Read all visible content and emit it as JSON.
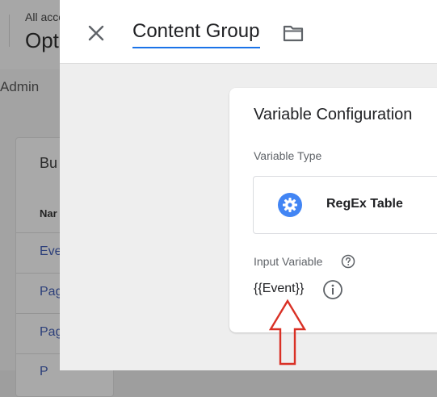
{
  "background": {
    "breadcrumb": "All acco",
    "account_name": "Opt",
    "admin_tab": "Admin",
    "card_title": "Bu",
    "column_header": "Nar",
    "rows": [
      "Eve",
      "Pag",
      "Pag",
      "P"
    ]
  },
  "panel": {
    "close_icon": "close-icon",
    "title": "Content Group",
    "folder_icon": "folder-icon",
    "card": {
      "title": "Variable Configuration",
      "variable_type_label": "Variable Type",
      "variable_type_name": "RegEx Table",
      "variable_type_icon": "gear-icon",
      "input_variable_label": "Input Variable",
      "help_icon": "help-circle-icon",
      "input_variable_value": "{{Event}}",
      "info_icon": "info-icon"
    }
  },
  "annotation": {
    "icon": "arrow-up-outline-icon",
    "color": "#d93025"
  },
  "colors": {
    "accent": "#1a73e8",
    "gear_badge": "#4285f4",
    "link": "#3c5ba9"
  }
}
